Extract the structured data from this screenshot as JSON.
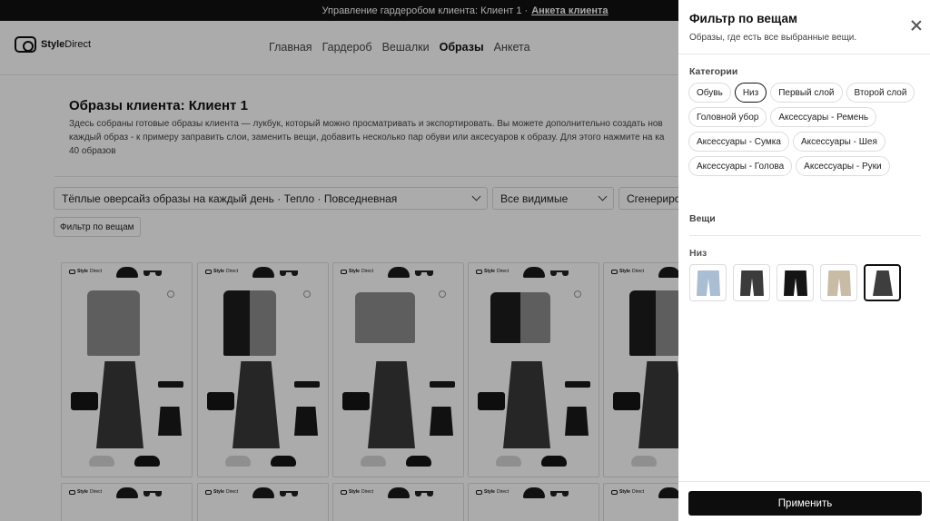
{
  "topbar": {
    "text": "Управление гардеробом клиента: Клиент 1 ·",
    "link": "Анкета клиента"
  },
  "header": {
    "logo_bold": "Style",
    "logo_rest": "Direct",
    "nav": [
      "Главная",
      "Гардероб",
      "Вешалки",
      "Образы",
      "Анкета"
    ],
    "active_nav": "Образы"
  },
  "main": {
    "title": "Образы клиента: Клиент 1",
    "description_1": "Здесь собраны готовые образы клиента — лукбук, который можно просматривать и экспортировать. Вы можете дополнительно создать нов",
    "description_2": "каждый образ - к примеру заправить слои, заменить вещи, добавить несколько пар обуви или аксесуаров к образу. Для этого нажмите на ка",
    "count": "40 образов",
    "select_collection": "Тёплые оверсайз образы на каждый день · Тепло · Повседневная",
    "select_visibility": "Все видимые",
    "select_generated": "Сгенериров",
    "filter_button": "Фильтр по вещам"
  },
  "drawer": {
    "title": "Фильтр по вещам",
    "subtitle": "Образы, где есть все выбранные вещи.",
    "categories_label": "Категории",
    "categories": [
      {
        "label": "Обувь",
        "selected": false
      },
      {
        "label": "Низ",
        "selected": true
      },
      {
        "label": "Первый слой",
        "selected": false
      },
      {
        "label": "Второй слой",
        "selected": false
      },
      {
        "label": "Головной убор",
        "selected": false
      },
      {
        "label": "Аксессуары - Ремень",
        "selected": false
      },
      {
        "label": "Аксессуары - Сумка",
        "selected": false
      },
      {
        "label": "Аксессуары - Шея",
        "selected": false
      },
      {
        "label": "Аксессуары - Голова",
        "selected": false
      },
      {
        "label": "Аксессуары - Руки",
        "selected": false
      }
    ],
    "items_label": "Вещи",
    "group_label": "Низ",
    "items": [
      {
        "name": "light-blue-jeans-thumb",
        "color": "#a9bdd3",
        "kind": "pants",
        "selected": false
      },
      {
        "name": "black-washed-jeans-thumb",
        "color": "#3b3b3b",
        "kind": "pants",
        "selected": false
      },
      {
        "name": "black-wide-trousers-thumb",
        "color": "#151515",
        "kind": "pants",
        "selected": false
      },
      {
        "name": "beige-trousers-thumb",
        "color": "#c9bca7",
        "kind": "pants",
        "selected": false
      },
      {
        "name": "denim-maxi-skirt-thumb",
        "color": "#3e3e3e",
        "kind": "skirt",
        "selected": true
      }
    ],
    "apply_label": "Применить"
  },
  "colors": {
    "accent": "#0d0d0d",
    "overlay": "rgba(0,0,0,0.33)"
  }
}
